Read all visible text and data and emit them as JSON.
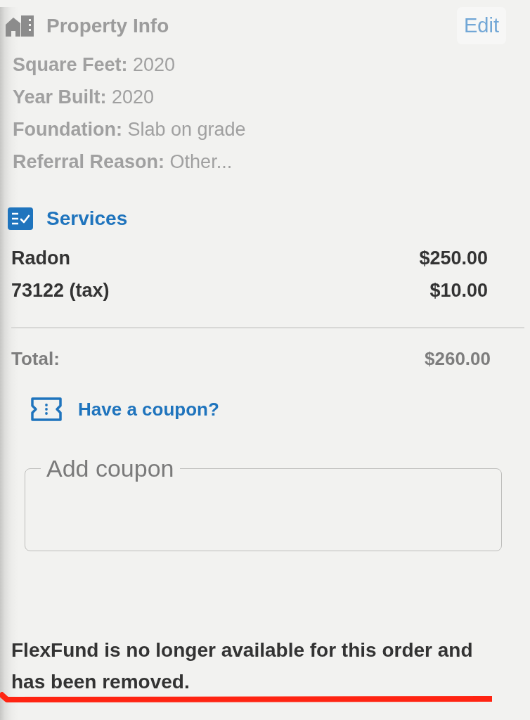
{
  "property_info": {
    "title": "Property Info",
    "edit_button": "Edit",
    "fields": [
      {
        "label": "Square Feet:",
        "value": "2020"
      },
      {
        "label": "Year Built:",
        "value": "2020"
      },
      {
        "label": "Foundation:",
        "value": "Slab on grade"
      },
      {
        "label": "Referral Reason:",
        "value": "Other..."
      }
    ]
  },
  "services": {
    "title": "Services",
    "items": [
      {
        "name": "Radon",
        "price": "$250.00"
      },
      {
        "name": "73122 (tax)",
        "price": "$10.00"
      }
    ],
    "total": {
      "label": "Total:",
      "value": "$260.00"
    }
  },
  "coupon": {
    "link": "Have a coupon?",
    "field": {
      "label": "Add coupon"
    }
  },
  "notice": "FlexFund is no longer available for this order and has been removed."
}
